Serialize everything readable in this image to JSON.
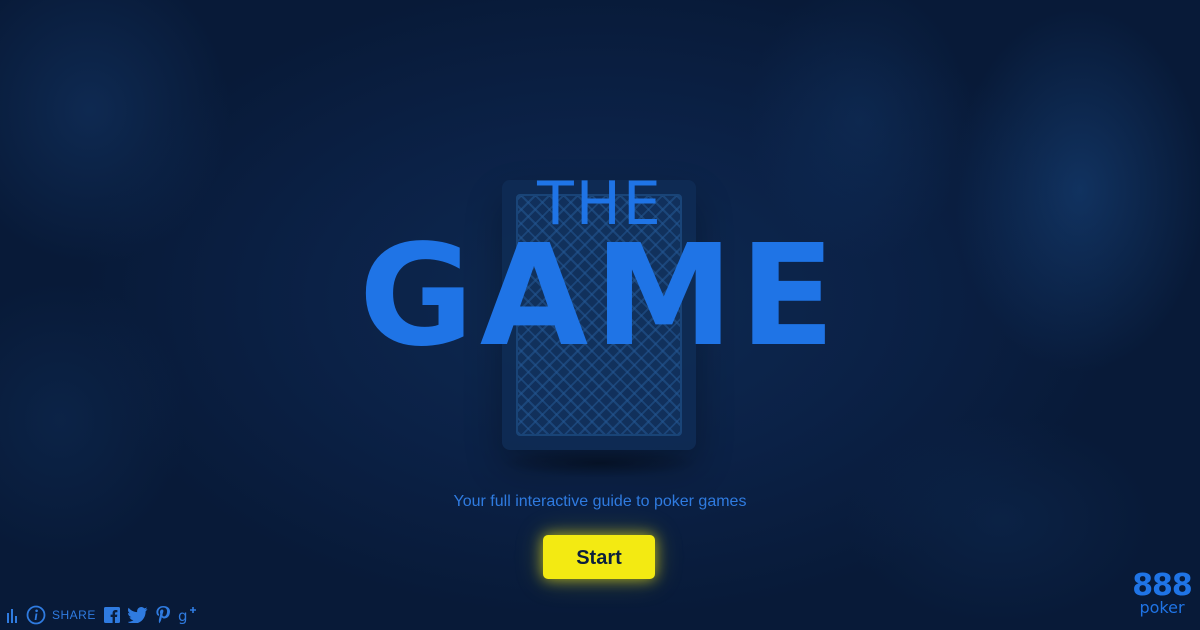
{
  "title": {
    "line1": "THE",
    "line2": "GAME"
  },
  "subtitle": "Your full interactive guide to poker games",
  "start_button": {
    "label": "Start",
    "color": "#f3ea12"
  },
  "toolbar": {
    "stats_icon": "bar-chart-icon",
    "info_icon": "info-icon",
    "share_label": "SHARE",
    "facebook_icon": "facebook-icon",
    "twitter_icon": "twitter-icon",
    "pinterest_icon": "pinterest-icon",
    "googleplus_icon": "google-plus-icon"
  },
  "brand": {
    "number": "888",
    "word": "poker"
  },
  "colors": {
    "background": "#0b1f3d",
    "accent_blue": "#1f74e6",
    "button_yellow": "#f3ea12"
  }
}
